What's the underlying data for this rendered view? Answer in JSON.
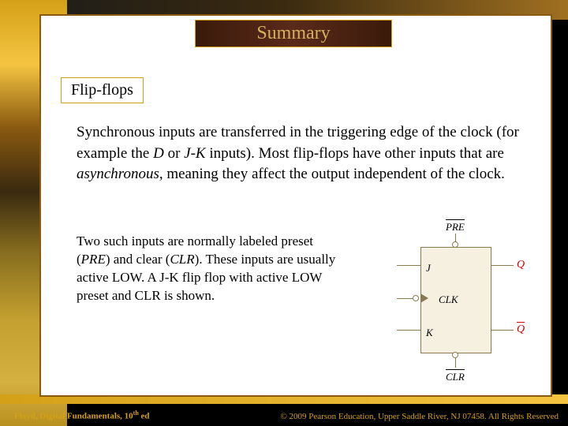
{
  "title": "Summary",
  "subtitle": "Flip-flops",
  "paragraph1": {
    "pre": "Synchronous inputs are transferred in the triggering edge of the clock (for example the ",
    "d": "D",
    "mid1": " or ",
    "jk": "J-K",
    "mid2": " inputs). Most flip-flops have other inputs that are ",
    "async": "asynchronous",
    "post": ", meaning they affect the output independent of the clock."
  },
  "paragraph2": {
    "pre": "Two such inputs are normally labeled preset (",
    "pre_lbl": "PRE",
    "mid1": ") and clear (",
    "clr_lbl": "CLR",
    "post": "). These inputs are usually active LOW. A J-K flip flop with active LOW preset and CLR is shown."
  },
  "diagram": {
    "pre": "PRE",
    "clr": "CLR",
    "j": "J",
    "k": "K",
    "clk": "CLK",
    "q": "Q",
    "qbar": "Q"
  },
  "footer": {
    "left_pre": "Floyd, Digital Fundamentals, 10",
    "left_sup": "th",
    "left_post": " ed",
    "right": "© 2009 Pearson Education, Upper Saddle River, NJ 07458. All Rights Reserved"
  }
}
